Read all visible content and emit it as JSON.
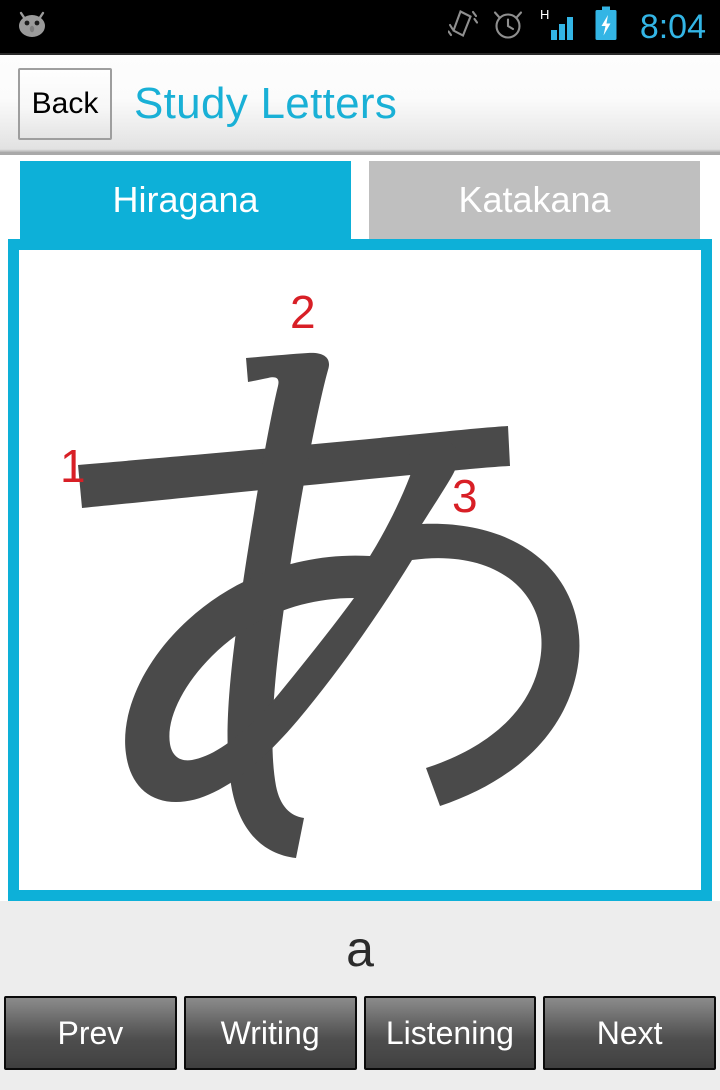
{
  "statusbar": {
    "notification_icon": "android-head-icon",
    "icons": [
      {
        "name": "vibrate-icon"
      },
      {
        "name": "alarm-clock-icon"
      },
      {
        "name": "hspa-signal-icon",
        "label": "H"
      },
      {
        "name": "battery-charging-icon"
      }
    ],
    "time": "8:04",
    "time_color": "#33b5e5",
    "background": "#000000"
  },
  "header": {
    "back_label": "Back",
    "title": "Study Letters",
    "title_color": "#19b0d6"
  },
  "tabs": [
    {
      "label": "Hiragana",
      "active": true,
      "color": "#0db0d8"
    },
    {
      "label": "Katakana",
      "active": false,
      "color": "#bfbfbf"
    }
  ],
  "character_panel": {
    "border_color": "#0db0d8",
    "character": "あ",
    "character_color": "#4a4a4a",
    "stroke_numbers": [
      "1",
      "2",
      "3"
    ],
    "stroke_number_color": "#d81f26",
    "stroke_count": 3
  },
  "reading": {
    "romaji": "a"
  },
  "actions": [
    {
      "label": "Prev"
    },
    {
      "label": "Writing"
    },
    {
      "label": "Listening"
    },
    {
      "label": "Next"
    }
  ]
}
